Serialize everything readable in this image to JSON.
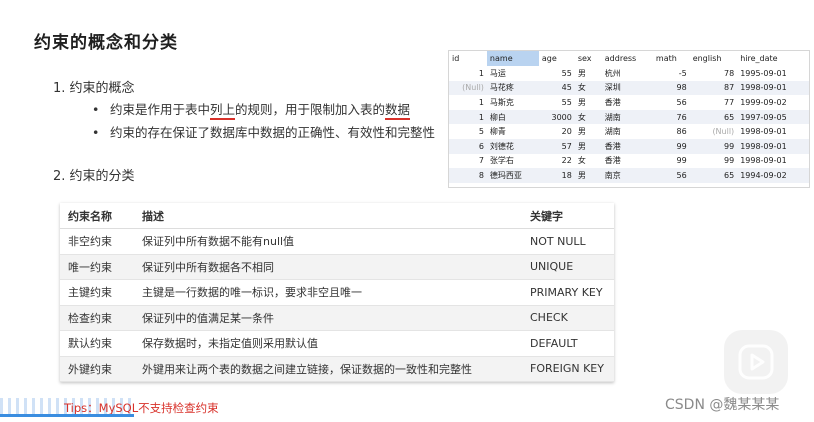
{
  "title": "约束的概念和分类",
  "section1": {
    "heading": "1. 约束的概念",
    "bullet1_parts": [
      "约束是作用于表中",
      "列上",
      "的规则，用于限制加入表的",
      "数据"
    ],
    "bullet2": "约束的存在保证了数据库中数据的正确性、有效性和完整性"
  },
  "section2": {
    "heading": "2. 约束的分类"
  },
  "data_table": {
    "headers": [
      "id",
      "name",
      "age",
      "sex",
      "address",
      "math",
      "english",
      "hire_date"
    ],
    "rows": [
      [
        "1",
        "马运",
        "55",
        "男",
        "杭州",
        "-5",
        "78",
        "1995-09-01"
      ],
      [
        "(Null)",
        "马花疼",
        "45",
        "女",
        "深圳",
        "98",
        "87",
        "1998-09-01"
      ],
      [
        "1",
        "马斯克",
        "55",
        "男",
        "香港",
        "56",
        "77",
        "1999-09-02"
      ],
      [
        "1",
        "柳白",
        "3000",
        "女",
        "湖南",
        "76",
        "65",
        "1997-09-05"
      ],
      [
        "5",
        "柳青",
        "20",
        "男",
        "湖南",
        "86",
        "(Null)",
        "1998-09-01"
      ],
      [
        "6",
        "刘德花",
        "57",
        "男",
        "香港",
        "99",
        "99",
        "1998-09-01"
      ],
      [
        "7",
        "张学右",
        "22",
        "女",
        "香港",
        "99",
        "99",
        "1998-09-01"
      ],
      [
        "8",
        "德玛西亚",
        "18",
        "男",
        "南京",
        "56",
        "65",
        "1994-09-02"
      ]
    ]
  },
  "constraint_table": {
    "headers": [
      "约束名称",
      "描述",
      "关键字"
    ],
    "rows": [
      [
        "非空约束",
        "保证列中所有数据不能有null值",
        "NOT NULL"
      ],
      [
        "唯一约束",
        "保证列中所有数据各不相同",
        "UNIQUE"
      ],
      [
        "主键约束",
        "主键是一行数据的唯一标识，要求非空且唯一",
        "PRIMARY KEY"
      ],
      [
        "检查约束",
        "保证列中的值满足某一条件",
        "CHECK"
      ],
      [
        "默认约束",
        "保存数据时，未指定值则采用默认值",
        "DEFAULT"
      ],
      [
        "外键约束",
        "外键用来让两个表的数据之间建立链接，保证数据的一致性和完整性",
        "FOREIGN KEY"
      ]
    ]
  },
  "tips": "Tips：MySQL不支持检查约束",
  "watermark": "CSDN @魏某某某",
  "colors": {
    "accent_red": "#d8312a",
    "selection_blue": "#b9d3f0",
    "progress_blue": "#3a8de0"
  },
  "icons": {
    "play": "play-icon"
  }
}
